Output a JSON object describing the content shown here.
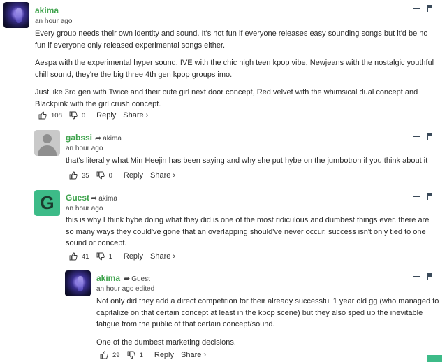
{
  "comments": [
    {
      "user": "akima",
      "time": "an hour ago",
      "paragraphs": [
        "Every group needs their own identity and sound. It's not fun if everyone releases easy sounding songs but it'd be no fun if everyone only released experimental songs either.",
        "Aespa with the experimental hyper sound, IVE with the chic high teen kpop vibe, Newjeans with the nostalgic youthful chill sound, they're the big three 4th gen kpop groups imo.",
        "Just like 3rd gen with Twice and their cute girl next door concept, Red velvet with the whimsical dual concept and Blackpink with the girl crush concept."
      ],
      "upvotes": "108",
      "downvotes": "0",
      "reply_label": "Reply",
      "share_label": "Share ›"
    },
    {
      "user": "gabssi",
      "reply_to": "akima",
      "time": "an hour ago",
      "paragraphs": [
        "that's literally what Min Heejin has been saying and why she put hybe on the jumbotron if you think about it"
      ],
      "upvotes": "35",
      "downvotes": "0",
      "reply_label": "Reply",
      "share_label": "Share ›"
    },
    {
      "user": "Guest",
      "avatar_letter": "G",
      "reply_to": "akima",
      "time": "an hour ago",
      "paragraphs": [
        "this is why I think hybe doing what they did is one of the most ridiculous and dumbest things ever. there are so many ways they could've gone that an overlapping should've never occur. success isn't only tied to one sound or concept."
      ],
      "upvotes": "41",
      "downvotes": "1",
      "reply_label": "Reply",
      "share_label": "Share ›"
    },
    {
      "user": "akima",
      "reply_to": "Guest",
      "time": "an hour ago",
      "edited": "edited",
      "paragraphs": [
        "Not only did they add a direct competition for their already successful 1 year old gg (who managed to capitalize on that certain concept at least in the kpop scene) but they also sped up the inevitable fatigue from the public of that certain concept/sound.",
        "One of the dumbest marketing decisions."
      ],
      "upvotes": "29",
      "downvotes": "1",
      "reply_label": "Reply",
      "share_label": "Share ›"
    }
  ],
  "colors": {
    "username": "#3fa34d",
    "guest_avatar": "#3dbb88"
  },
  "icons": [
    "thumbs-up-icon",
    "thumbs-down-icon",
    "reply-arrow-icon",
    "collapse-icon",
    "flag-icon"
  ]
}
